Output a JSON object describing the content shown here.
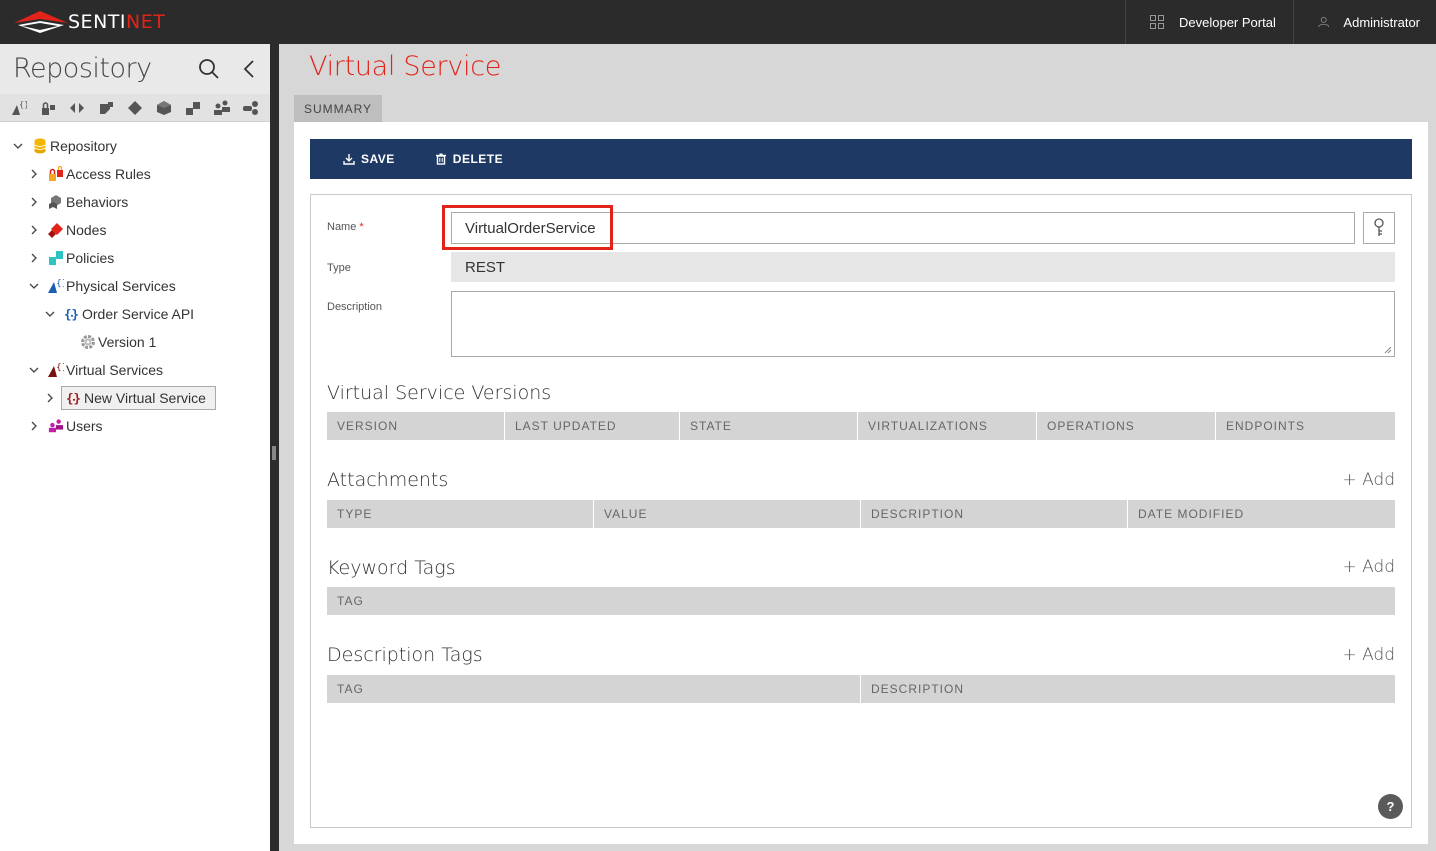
{
  "app": {
    "brand_left": "SENTI",
    "brand_right": "NET",
    "brand_color": "#e2231a",
    "nav": [
      {
        "label": "Developer Portal",
        "icon": "grid-icon"
      },
      {
        "label": "Administrator",
        "icon": "user-icon"
      }
    ]
  },
  "sidebar": {
    "title": "Repository",
    "toolbar_icons": [
      "physical-service-icon",
      "lock-icon",
      "virtual-service-icon",
      "shape-icon",
      "diamond-icon",
      "cube-icon",
      "policy-icon",
      "users-icon",
      "behaviors-icon"
    ],
    "tree": [
      {
        "label": "Repository",
        "icon": "database-icon",
        "expanded": true
      },
      {
        "label": "Access Rules",
        "icon": "lock-icon"
      },
      {
        "label": "Behaviors",
        "icon": "cubes-icon"
      },
      {
        "label": "Nodes",
        "icon": "diamond-icon"
      },
      {
        "label": "Policies",
        "icon": "policy-icon"
      },
      {
        "label": "Physical Services",
        "icon": "physical-services-icon",
        "expanded": true
      },
      {
        "label": "Order Service API",
        "icon": "braces-icon",
        "expanded": true
      },
      {
        "label": "Version 1",
        "icon": "gear-icon"
      },
      {
        "label": "Virtual Services",
        "icon": "virtual-services-icon",
        "expanded": true
      },
      {
        "label": "New Virtual Service",
        "icon": "braces-icon",
        "selected": true
      },
      {
        "label": "Users",
        "icon": "users-icon"
      }
    ]
  },
  "main": {
    "title": "Virtual Service",
    "tab": "SUMMARY",
    "actions": {
      "save": "SAVE",
      "delete": "DELETE"
    },
    "form": {
      "name_label": "Name",
      "required_mark": "*",
      "name_value": "VirtualOrderService",
      "type_label": "Type",
      "type_value": "REST",
      "description_label": "Description",
      "description_value": ""
    },
    "sections": {
      "versions": {
        "title": "Virtual Service Versions",
        "columns": [
          "VERSION",
          "LAST UPDATED",
          "STATE",
          "VIRTUALIZATIONS",
          "OPERATIONS",
          "ENDPOINTS"
        ]
      },
      "attachments": {
        "title": "Attachments",
        "add": "+ Add",
        "columns": [
          "TYPE",
          "VALUE",
          "DESCRIPTION",
          "DATE MODIFIED"
        ]
      },
      "keyword_tags": {
        "title": "Keyword Tags",
        "add": "+ Add",
        "columns": [
          "TAG"
        ]
      },
      "description_tags": {
        "title": "Description Tags",
        "add": "+ Add",
        "columns": [
          "TAG",
          "DESCRIPTION"
        ]
      }
    },
    "help": "?"
  }
}
